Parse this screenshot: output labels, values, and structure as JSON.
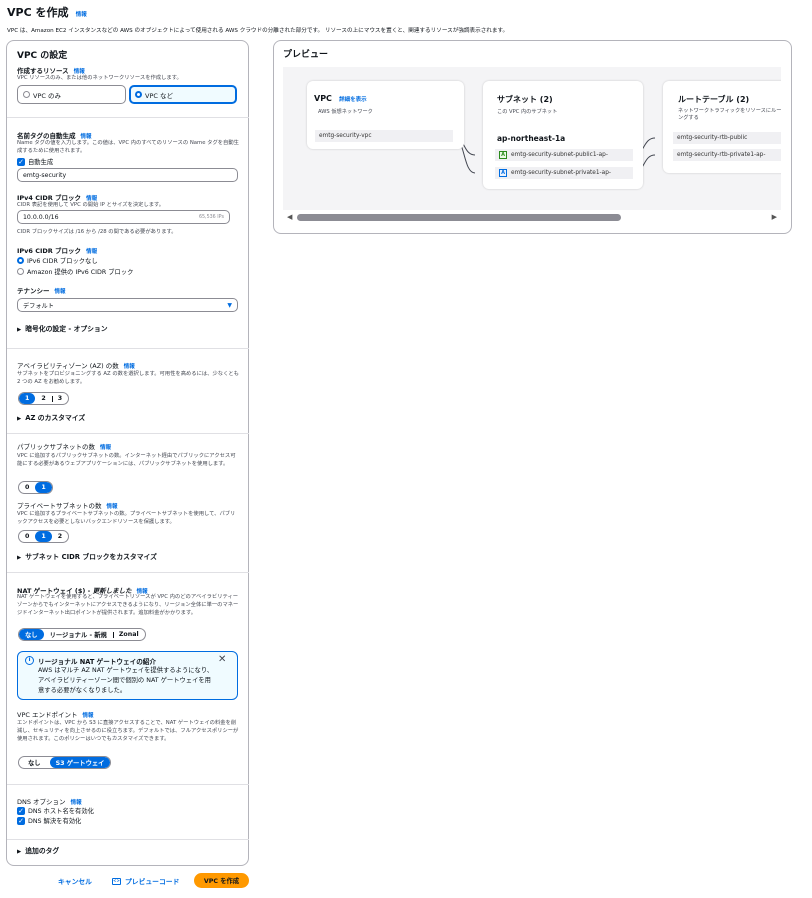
{
  "header": {
    "title": "VPC を作成",
    "info": "情報",
    "description": "VPC は、Amazon EC2 インスタンスなどの AWS のオブジェクトによって使用される AWS クラウドの分離された部分です。 リソースの上にマウスを置くと、関連するリソースが強調表示されます。"
  },
  "settings": {
    "title": "VPC の設定",
    "resources": {
      "label": "作成するリソース",
      "info": "情報",
      "desc": "VPC リソースのみ、または他のネットワークリソースを作成します。",
      "opt_vpc_only": "VPC のみ",
      "opt_vpc_more": "VPC など"
    },
    "name_tag": {
      "label": "名前タグの自動生成",
      "info": "情報",
      "desc": "Name タグの値を入力します。この値は、VPC 内のすべてのリソースの Name タグを自動生成するために使用されます。",
      "auto_label": "自動生成",
      "value": "emtg-security"
    },
    "ipv4": {
      "label": "IPv4 CIDR ブロック",
      "info": "情報",
      "desc": "CIDR 表記を使用して VPC の開始 IP とサイズを決定します。",
      "value": "10.0.0.0/16",
      "count": "65,536 IPs",
      "constraint": "CIDR ブロックサイズは /16 から /28 の間である必要があります。"
    },
    "ipv6": {
      "label": "IPv6 CIDR ブロック",
      "info": "情報",
      "opt_none": "IPv6 CIDR ブロックなし",
      "opt_amazon": "Amazon 提供の IPv6 CIDR ブロック"
    },
    "tenancy": {
      "label": "テナンシー",
      "info": "情報",
      "value": "デフォルト"
    },
    "encryption_label": "暗号化の設定 - オプション",
    "az": {
      "label": "アベイラビリティゾーン (AZ) の数",
      "info": "情報",
      "desc": "サブネットをプロビジョニングする AZ の数を選択します。可用性を高めるには、少なくとも 2 つの AZ をお勧めします。",
      "options": [
        "1",
        "2",
        "3"
      ],
      "customize": "AZ のカスタマイズ"
    },
    "public_subnets": {
      "label": "パブリックサブネットの数",
      "info": "情報",
      "desc": "VPC に追加するパブリックサブネットの数。インターネット経由でパブリックにアクセス可能にする必要があるウェブアプリケーションには、パブリックサブネットを使用します。",
      "options": [
        "0",
        "1"
      ]
    },
    "private_subnets": {
      "label": "プライベートサブネットの数",
      "info": "情報",
      "desc": "VPC に追加するプライベートサブネットの数。プライベートサブネットを使用して、パブリックアクセスを必要としないバックエンドリソースを保護します。",
      "options": [
        "0",
        "1",
        "2"
      ],
      "customize": "サブネット CIDR ブロックをカスタマイズ"
    },
    "nat": {
      "label": "NAT ゲートウェイ ($) - ",
      "label_em": "更新しました",
      "info": "情報",
      "desc": "NAT ゲートウェイを使用すると、プライベートリソースが VPC 内のどのアベイラビリティーゾーンからでもインターネットにアクセスできるようになり、リージョン全体に単一のマネージドインターネット出口ポイントが提供されます。追加料金がかかります。",
      "options": [
        "なし",
        "リージョナル - 新規",
        "Zonal"
      ]
    },
    "nat_notice": {
      "title": "リージョナル NAT ゲートウェイの紹介",
      "body": "AWS はマルチ AZ NAT ゲートウェイを提供するようになり、アベイラビリティーゾーン間で個別の NAT ゲートウェイを用意する必要がなくなりました。"
    },
    "endpoint": {
      "label": "VPC エンドポイント",
      "info": "情報",
      "desc": "エンドポイントは、VPC から S3 に直接アクセスすることで、NAT ゲートウェイの料金を削減し、セキュリティを向上させるのに役立ちます。デフォルトでは、フルアクセスポリシーが使用されます。このポリシーはいつでもカスタマイズできます。",
      "options": [
        "なし",
        "S3 ゲートウェイ"
      ]
    },
    "dns": {
      "label": "DNS オプション",
      "info": "情報",
      "hostname": "DNS ホスト名を有効化",
      "resolution": "DNS 解決を有効化"
    },
    "tags_label": "追加のタグ"
  },
  "footer": {
    "cancel": "キャンセル",
    "preview_code": "プレビューコード",
    "create": "VPC を作成"
  },
  "preview": {
    "title": "プレビュー",
    "vpc": {
      "title": "VPC",
      "link": "詳細を表示",
      "sub": "AWS 仮想ネットワーク",
      "item": "emtg-security-vpc"
    },
    "subnets": {
      "title": "サブネット (2)",
      "sub": "この VPC 内のサブネット",
      "az": "ap-northeast-1a",
      "items": [
        {
          "badge": "A",
          "name": "emtg-security-subnet-public1-ap-"
        },
        {
          "badge": "A",
          "name": "emtg-security-subnet-private1-ap-"
        }
      ]
    },
    "route_tables": {
      "title": "ルートテーブル (2)",
      "sub": "ネットワークトラフィックをリソースにルーティングする",
      "items": [
        "emtg-security-rtb-public",
        "emtg-security-rtb-private1-ap-"
      ]
    }
  }
}
